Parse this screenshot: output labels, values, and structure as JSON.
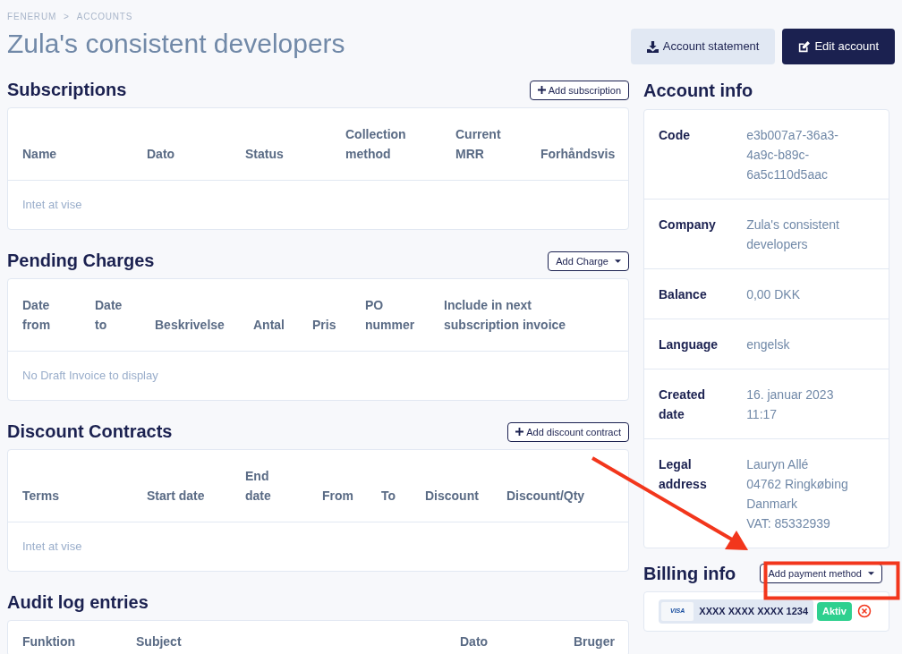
{
  "breadcrumb": {
    "items": [
      "FENERUM",
      "ACCOUNTS"
    ],
    "separator": ">"
  },
  "title": "Zula's consistent developers",
  "header_buttons": [
    {
      "label": "Account statement",
      "kind": "secondary"
    },
    {
      "label": "Edit account",
      "kind": "primary"
    }
  ],
  "sections": [
    {
      "title": "Subscriptions",
      "button": {
        "label": "Add subscription",
        "kind": "add"
      },
      "columns": [
        "Name",
        "Dato",
        "Status",
        "Collection method",
        "Current MRR",
        "Forhåndsvis"
      ],
      "empty_text": "Intet at vise"
    },
    {
      "title": "Pending Charges",
      "button": {
        "label": "Add Charge",
        "kind": "dropdown"
      },
      "columns": [
        "Date from",
        "Date to",
        "Beskrivelse",
        "Antal",
        "Pris",
        "PO nummer",
        "Include in next subscription invoice"
      ],
      "empty_text": "No Draft Invoice to display"
    },
    {
      "title": "Discount Contracts",
      "button": {
        "label": "Add discount contract",
        "kind": "add"
      },
      "columns": [
        "Terms",
        "Start date",
        "End date",
        "From",
        "To",
        "Discount",
        "Discount/Qty"
      ],
      "empty_text": "Intet at vise"
    },
    {
      "title": "Audit log entries",
      "columns": [
        "Funktion",
        "Subject",
        "Dato",
        "Bruger"
      ]
    }
  ],
  "account_info": {
    "title": "Account info",
    "rows": [
      {
        "label": "Code",
        "lines": [
          "e3b007a7-36a3-",
          "4a9c-b89c-",
          "6a5c110d5aac"
        ]
      },
      {
        "label": "Company",
        "lines": [
          "Zula's consistent",
          "developers"
        ]
      },
      {
        "label": "Balance",
        "lines": [
          "0,00 DKK"
        ]
      },
      {
        "label": "Language",
        "lines": [
          "engelsk"
        ]
      },
      {
        "label": "Created date",
        "lines": [
          "16. januar 2023",
          "11:17"
        ]
      },
      {
        "label": "Legal address",
        "lines": [
          "Lauryn Allé",
          "04762 Ringkøbing",
          "Danmark",
          "VAT: 85332939"
        ]
      }
    ]
  },
  "billing_info": {
    "title": "Billing info",
    "button": {
      "label": "Add payment method",
      "kind": "dropdown"
    },
    "payment_methods": [
      {
        "brand": "VISA",
        "number": "XXXX XXXX XXXX 1234",
        "status": "Aktiv",
        "active": true
      }
    ]
  }
}
